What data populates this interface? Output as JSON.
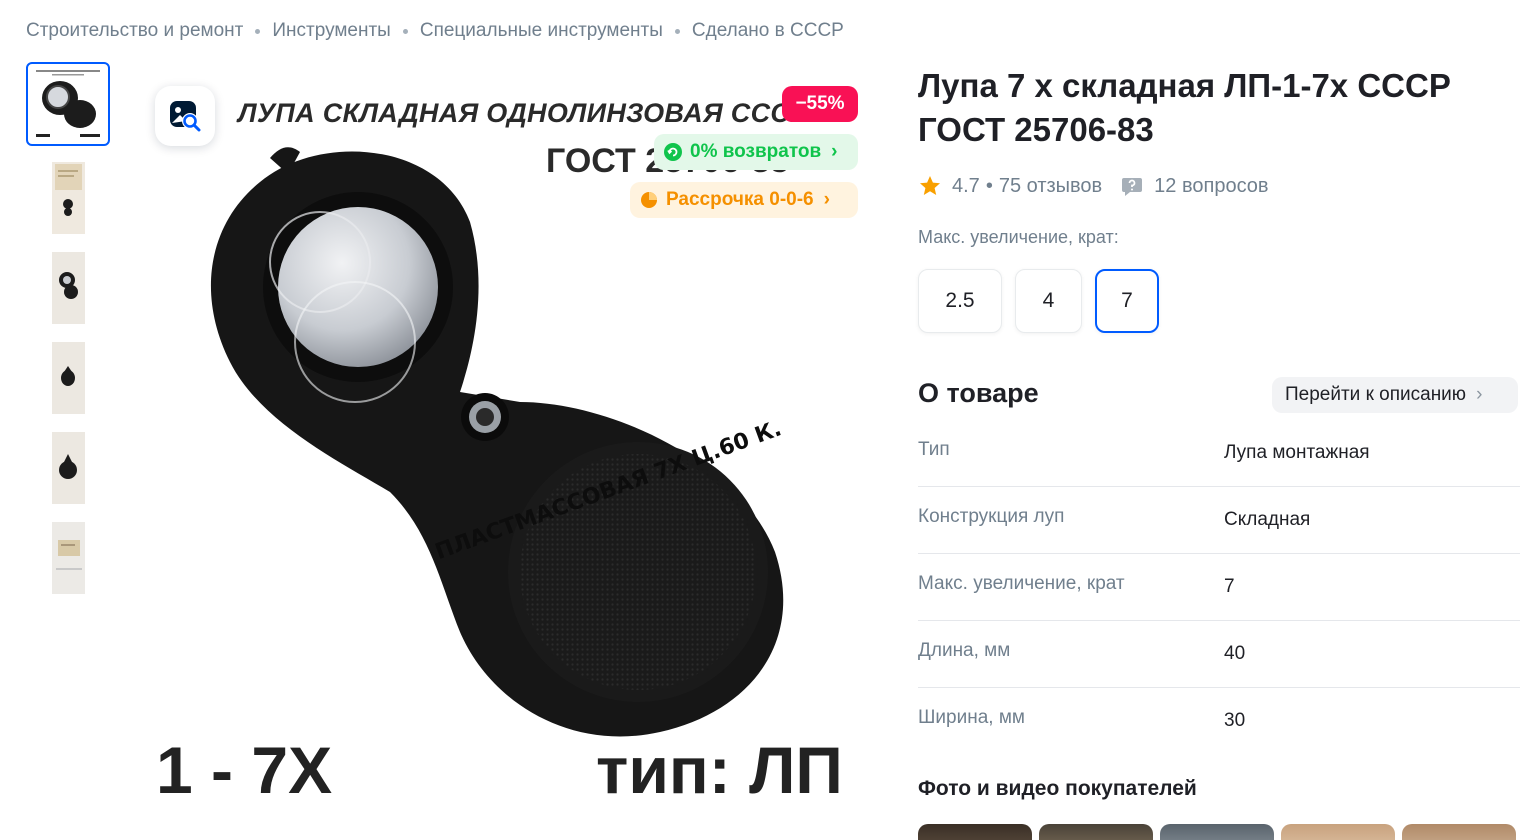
{
  "breadcrumbs": [
    "Строительство и ремонт",
    "Инструменты",
    "Специальные инструменты",
    "Сделано в СССР"
  ],
  "thumbnails": {
    "count": 6,
    "active_index": 0
  },
  "main_image": {
    "headline": "ЛУПА СКЛАДНАЯ ОДНОЛИНЗОВАЯ СССР",
    "gost": "ГОСТ 25706-83",
    "big_left": "1 - 7X",
    "big_right": "тип: ЛП",
    "body_text": "ПЛАСТМАССОВАЯ 7X Ц.60 К."
  },
  "badges": {
    "discount": "−55%",
    "returns": "0% возвратов",
    "installment": "Рассрочка 0-0-6"
  },
  "product": {
    "title": "Лупа 7 х складная ЛП-1-7х СССР ГОСТ 25706-83",
    "rating": "4.7",
    "reviews": "75 отзывов",
    "questions": "12 вопросов"
  },
  "variant_selector": {
    "label": "Макс. увеличение, крат:",
    "options": [
      "2.5",
      "4",
      "7"
    ],
    "selected": "7"
  },
  "about": {
    "title": "О товаре",
    "link": "Перейти к описанию",
    "specs": [
      {
        "name": "Тип",
        "value": "Лупа монтажная"
      },
      {
        "name": "Конструкция луп",
        "value": "Складная"
      },
      {
        "name": "Макс. увеличение, крат",
        "value": "7"
      },
      {
        "name": "Длина, мм",
        "value": "40"
      },
      {
        "name": "Ширина, мм",
        "value": "30"
      }
    ]
  },
  "customer_photos": {
    "title": "Фото и видео покупателей",
    "count": 5
  },
  "colors": {
    "accent": "#005bff",
    "discount": "#f91155",
    "returns": "#10c44c",
    "installment": "#f59000",
    "star": "#f9a000"
  },
  "icons": [
    "image-search-icon",
    "returns-icon",
    "installment-icon",
    "star-icon",
    "question-icon",
    "chevron-right-icon"
  ]
}
